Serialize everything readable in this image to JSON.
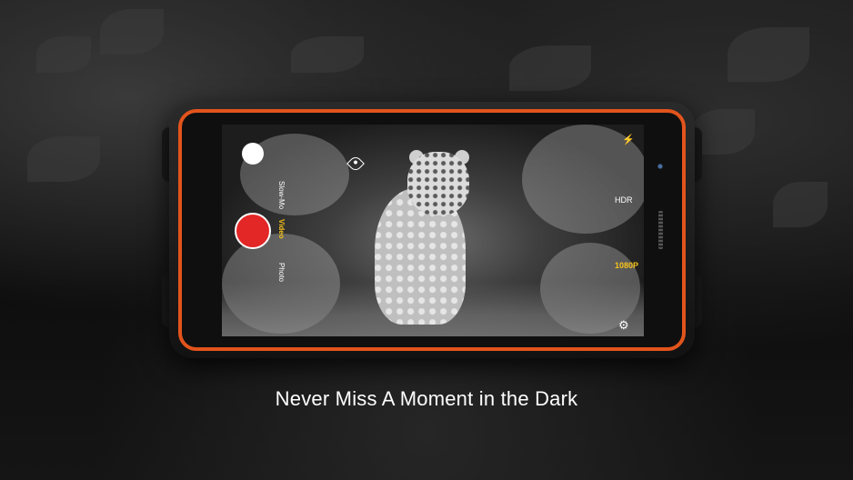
{
  "caption": "Never Miss A Moment in the Dark",
  "camera": {
    "modes": [
      {
        "label": "Slow-Mo",
        "active": false
      },
      {
        "label": "Video",
        "active": true
      },
      {
        "label": "Photo",
        "active": false
      }
    ],
    "resolution": "1080P",
    "hdr": "HDR"
  },
  "colors": {
    "accent": "#e2541c",
    "record": "#e32626",
    "active_mode": "#f7c21a"
  },
  "icons": [
    "shutter-button",
    "record-button",
    "eye-icon",
    "flash-icon",
    "gear-icon"
  ]
}
